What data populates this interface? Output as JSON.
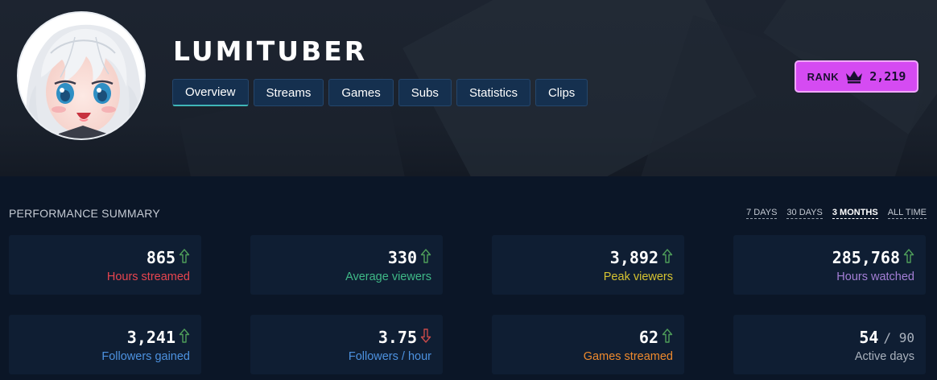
{
  "channel": {
    "name": "LUMITUBER"
  },
  "tabs": [
    {
      "label": "Overview"
    },
    {
      "label": "Streams"
    },
    {
      "label": "Games"
    },
    {
      "label": "Subs"
    },
    {
      "label": "Statistics"
    },
    {
      "label": "Clips"
    }
  ],
  "active_tab": "Overview",
  "rank": {
    "label": "RANK",
    "value": "2,219",
    "icon": "crown-icon",
    "color": "#d54bf2"
  },
  "summary": {
    "title": "PERFORMANCE SUMMARY",
    "periods": [
      "7 DAYS",
      "30 DAYS",
      "3 MONTHS",
      "ALL TIME"
    ],
    "active_period": "3 MONTHS",
    "stats": [
      {
        "value": "865",
        "label": "Hours streamed",
        "trend": "up",
        "label_color": "#e8454f"
      },
      {
        "value": "330",
        "label": "Average viewers",
        "trend": "up",
        "label_color": "#3fb987"
      },
      {
        "value": "3,892",
        "label": "Peak viewers",
        "trend": "up",
        "label_color": "#d6c331"
      },
      {
        "value": "285,768",
        "label": "Hours watched",
        "trend": "up",
        "label_color": "#a47fd6"
      },
      {
        "value": "3,241",
        "label": "Followers gained",
        "trend": "up",
        "label_color": "#4d92e0"
      },
      {
        "value": "3.75",
        "label": "Followers / hour",
        "trend": "down",
        "label_color": "#4d92e0"
      },
      {
        "value": "62",
        "label": "Games streamed",
        "trend": "up",
        "label_color": "#ef8a2d"
      },
      {
        "value": "54",
        "suffix": "/ 90",
        "label": "Active days",
        "trend": "none",
        "label_color": "#aab2bd"
      }
    ],
    "trend_colors": {
      "up": "#4f9e5a",
      "down": "#c84a4a"
    }
  }
}
